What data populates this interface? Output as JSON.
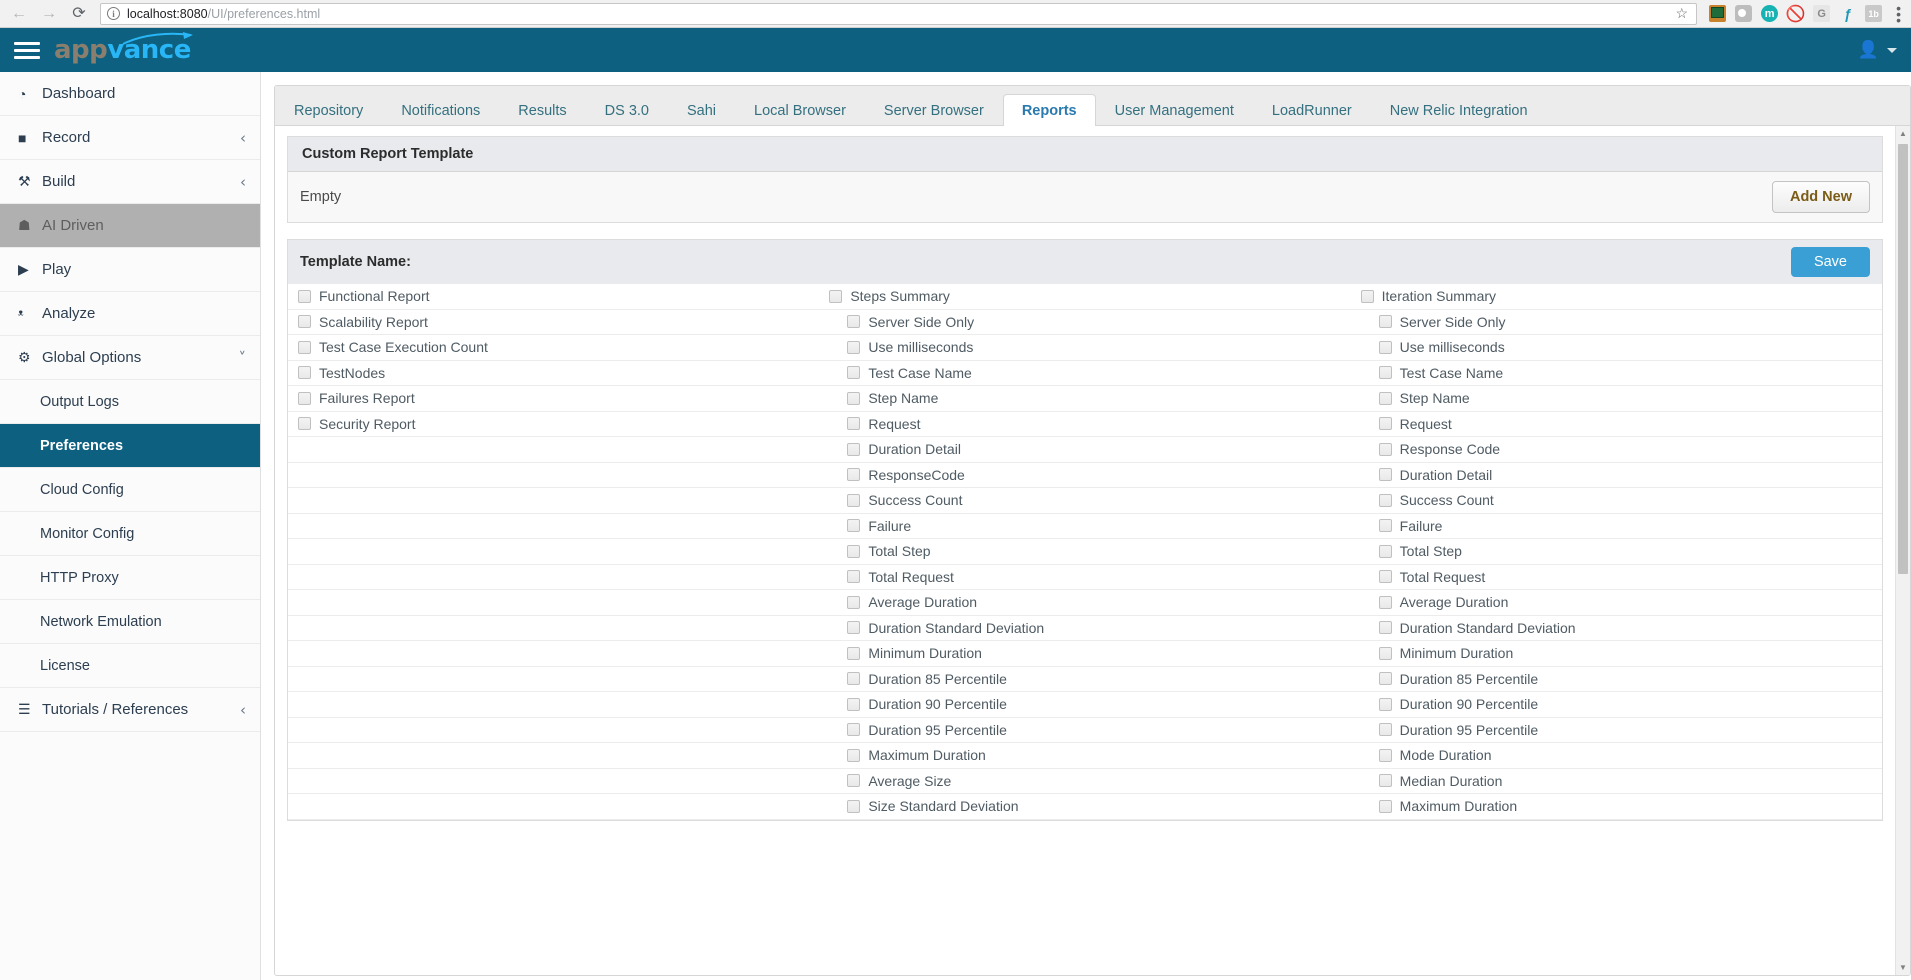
{
  "browser": {
    "url_host": "localhost:8080",
    "url_path": "/UI/preferences.html",
    "back_icon": "back-arrow-icon",
    "forward_icon": "forward-arrow-icon",
    "reload_icon": "reload-icon",
    "info_icon": "info-icon",
    "star_icon": "star-icon",
    "menu_icon": "kebab-menu-icon",
    "extensions": [
      {
        "name": "screen-capture-extension-icon",
        "glyph": ""
      },
      {
        "name": "gray-circle-extension-icon",
        "glyph": ""
      },
      {
        "name": "momentum-extension-icon",
        "glyph": "m"
      },
      {
        "name": "no-smoking-extension-icon",
        "glyph": "⃠"
      },
      {
        "name": "google-extension-icon",
        "glyph": "G"
      },
      {
        "name": "feedly-extension-icon",
        "glyph": "f"
      },
      {
        "name": "onetab-extension-icon",
        "glyph": "1b"
      }
    ]
  },
  "header": {
    "menu_toggle": "hamburger-menu",
    "brand_part1": "app",
    "brand_part2": "vance",
    "user_icon": "user-avatar-icon"
  },
  "sidebar": {
    "items": [
      {
        "label": "Dashboard",
        "icon": "dashboard-icon",
        "glyph": "◔",
        "chevron": "",
        "state": "normal",
        "level": 0
      },
      {
        "label": "Record",
        "icon": "video-camera-icon",
        "glyph": "■",
        "chevron": "‹",
        "state": "normal",
        "level": 0
      },
      {
        "label": "Build",
        "icon": "wrench-icon",
        "glyph": "⚒",
        "chevron": "‹",
        "state": "normal",
        "level": 0
      },
      {
        "label": "AI Driven",
        "icon": "cubes-icon",
        "glyph": "☗",
        "chevron": "",
        "state": "disabled",
        "level": 0
      },
      {
        "label": "Play",
        "icon": "play-icon",
        "glyph": "▶",
        "chevron": "",
        "state": "normal",
        "level": 0
      },
      {
        "label": "Analyze",
        "icon": "bar-chart-icon",
        "glyph": "ᵜ",
        "chevron": "",
        "state": "normal",
        "level": 0
      },
      {
        "label": "Global Options",
        "icon": "gears-icon",
        "glyph": "⚙",
        "chevron": "˅",
        "state": "expanded",
        "level": 0
      },
      {
        "label": "Output Logs",
        "icon": "",
        "glyph": "",
        "chevron": "",
        "state": "normal",
        "level": 1
      },
      {
        "label": "Preferences",
        "icon": "",
        "glyph": "",
        "chevron": "",
        "state": "active",
        "level": 1
      },
      {
        "label": "Cloud Config",
        "icon": "",
        "glyph": "",
        "chevron": "",
        "state": "normal",
        "level": 1
      },
      {
        "label": "Monitor Config",
        "icon": "",
        "glyph": "",
        "chevron": "",
        "state": "normal",
        "level": 1
      },
      {
        "label": "HTTP Proxy",
        "icon": "",
        "glyph": "",
        "chevron": "",
        "state": "normal",
        "level": 1
      },
      {
        "label": "Network Emulation",
        "icon": "",
        "glyph": "",
        "chevron": "",
        "state": "normal",
        "level": 1
      },
      {
        "label": "License",
        "icon": "",
        "glyph": "",
        "chevron": "",
        "state": "normal",
        "level": 1
      },
      {
        "label": "Tutorials / References",
        "icon": "book-icon",
        "glyph": "☰",
        "chevron": "‹",
        "state": "normal",
        "level": 0
      }
    ]
  },
  "tabs": [
    {
      "label": "Repository",
      "active": false
    },
    {
      "label": "Notifications",
      "active": false
    },
    {
      "label": "Results",
      "active": false
    },
    {
      "label": "DS 3.0",
      "active": false
    },
    {
      "label": "Sahi",
      "active": false
    },
    {
      "label": "Local Browser",
      "active": false
    },
    {
      "label": "Server Browser",
      "active": false
    },
    {
      "label": "Reports",
      "active": true
    },
    {
      "label": "User Management",
      "active": false
    },
    {
      "label": "LoadRunner",
      "active": false
    },
    {
      "label": "New Relic Integration",
      "active": false
    }
  ],
  "custom_report_template": {
    "title": "Custom Report Template",
    "empty_text": "Empty",
    "add_new_label": "Add New"
  },
  "template_form": {
    "title": "Template Name:",
    "save_label": "Save",
    "columns": [
      {
        "name": "report-types-column",
        "items": [
          {
            "label": "Functional Report",
            "checked": false,
            "indent": false
          },
          {
            "label": "Scalability Report",
            "checked": false,
            "indent": false
          },
          {
            "label": "Test Case Execution Count",
            "checked": false,
            "indent": false
          },
          {
            "label": "TestNodes",
            "checked": false,
            "indent": false
          },
          {
            "label": "Failures Report",
            "checked": false,
            "indent": false
          },
          {
            "label": "Security Report",
            "checked": false,
            "indent": false
          }
        ]
      },
      {
        "name": "steps-summary-column",
        "items": [
          {
            "label": "Steps Summary",
            "checked": false,
            "indent": false
          },
          {
            "label": "Server Side Only",
            "checked": false,
            "indent": true
          },
          {
            "label": "Use milliseconds",
            "checked": false,
            "indent": true
          },
          {
            "label": "Test Case Name",
            "checked": false,
            "indent": true
          },
          {
            "label": "Step Name",
            "checked": false,
            "indent": true
          },
          {
            "label": "Request",
            "checked": false,
            "indent": true
          },
          {
            "label": "Duration Detail",
            "checked": false,
            "indent": true
          },
          {
            "label": "ResponseCode",
            "checked": false,
            "indent": true
          },
          {
            "label": "Success Count",
            "checked": false,
            "indent": true
          },
          {
            "label": "Failure",
            "checked": false,
            "indent": true
          },
          {
            "label": "Total Step",
            "checked": false,
            "indent": true
          },
          {
            "label": "Total Request",
            "checked": false,
            "indent": true
          },
          {
            "label": "Average Duration",
            "checked": false,
            "indent": true
          },
          {
            "label": "Duration Standard Deviation",
            "checked": false,
            "indent": true
          },
          {
            "label": "Minimum Duration",
            "checked": false,
            "indent": true
          },
          {
            "label": "Duration 85 Percentile",
            "checked": false,
            "indent": true
          },
          {
            "label": "Duration 90 Percentile",
            "checked": false,
            "indent": true
          },
          {
            "label": "Duration 95 Percentile",
            "checked": false,
            "indent": true
          },
          {
            "label": "Maximum Duration",
            "checked": false,
            "indent": true
          },
          {
            "label": "Average Size",
            "checked": false,
            "indent": true
          },
          {
            "label": "Size Standard Deviation",
            "checked": false,
            "indent": true
          }
        ]
      },
      {
        "name": "iteration-summary-column",
        "items": [
          {
            "label": "Iteration Summary",
            "checked": false,
            "indent": false
          },
          {
            "label": "Server Side Only",
            "checked": false,
            "indent": true
          },
          {
            "label": "Use milliseconds",
            "checked": false,
            "indent": true
          },
          {
            "label": "Test Case Name",
            "checked": false,
            "indent": true
          },
          {
            "label": "Step Name",
            "checked": false,
            "indent": true
          },
          {
            "label": "Request",
            "checked": false,
            "indent": true
          },
          {
            "label": "Response Code",
            "checked": false,
            "indent": true
          },
          {
            "label": "Duration Detail",
            "checked": false,
            "indent": true
          },
          {
            "label": "Success Count",
            "checked": false,
            "indent": true
          },
          {
            "label": "Failure",
            "checked": false,
            "indent": true
          },
          {
            "label": "Total Step",
            "checked": false,
            "indent": true
          },
          {
            "label": "Total Request",
            "checked": false,
            "indent": true
          },
          {
            "label": "Average Duration",
            "checked": false,
            "indent": true
          },
          {
            "label": "Duration Standard Deviation",
            "checked": false,
            "indent": true
          },
          {
            "label": "Minimum Duration",
            "checked": false,
            "indent": true
          },
          {
            "label": "Duration 85 Percentile",
            "checked": false,
            "indent": true
          },
          {
            "label": "Duration 90 Percentile",
            "checked": false,
            "indent": true
          },
          {
            "label": "Duration 95 Percentile",
            "checked": false,
            "indent": true
          },
          {
            "label": "Mode Duration",
            "checked": false,
            "indent": true
          },
          {
            "label": "Median Duration",
            "checked": false,
            "indent": true
          },
          {
            "label": "Maximum Duration",
            "checked": false,
            "indent": true
          }
        ]
      }
    ]
  },
  "colors": {
    "brand_header": "#0d607f",
    "active_sidebar": "#0d607f",
    "save_button": "#3a9fd4",
    "tab_active_text": "#2a7ab0",
    "logo_blue": "#29b6f6"
  }
}
